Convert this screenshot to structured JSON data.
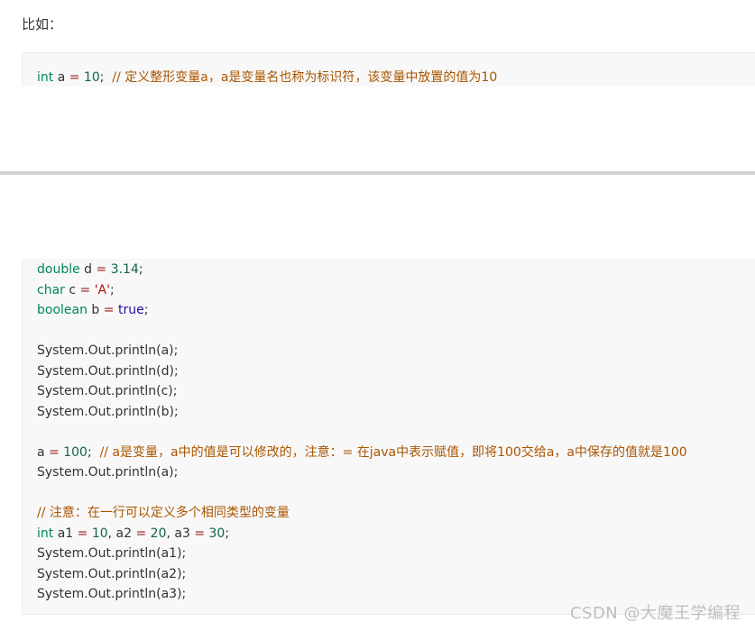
{
  "intro": {
    "label": "比如："
  },
  "top_code": {
    "kw": "int",
    "var": " a ",
    "op": "=",
    "num": " 10",
    "end": ";  ",
    "comment": "// 定义整形变量a，a是变量名也称为标识符，该变量中放置的值为10"
  },
  "bottom_code": {
    "l1": {
      "kw": "double",
      "var": " d ",
      "op": "=",
      "num": " 3.14",
      "end": ";"
    },
    "l2": {
      "kw": "char",
      "var": " c ",
      "op": "=",
      "str": " 'A'",
      "end": ";"
    },
    "l3": {
      "kw": "boolean",
      "var": " b ",
      "op": "=",
      "atom": " true",
      "end": ";"
    },
    "l4": "System.Out.println(a);",
    "l5": "System.Out.println(d);",
    "l6": "System.Out.println(c);",
    "l7": "System.Out.println(b);",
    "l8": {
      "var": "a ",
      "op": "=",
      "num": " 100",
      "end": ";  ",
      "comment": "// a是变量，a中的值是可以修改的，注意：= 在java中表示赋值，即将100交给a，a中保存的值就是100"
    },
    "l9": "System.Out.println(a);",
    "l10": "// 注意：在一行可以定义多个相同类型的变量",
    "l11": {
      "kw": "int",
      "v1": " a1 ",
      "op1": "=",
      "n1": " 10",
      "s1": ", a2 ",
      "op2": "=",
      "n2": " 20",
      "s2": ", a3 ",
      "op3": "=",
      "n3": " 30",
      "end": ";"
    },
    "l12": "System.Out.println(a1);",
    "l13": "System.Out.println(a2);",
    "l14": "System.Out.println(a3);"
  },
  "watermark": "CSDN @大魔王学编程"
}
